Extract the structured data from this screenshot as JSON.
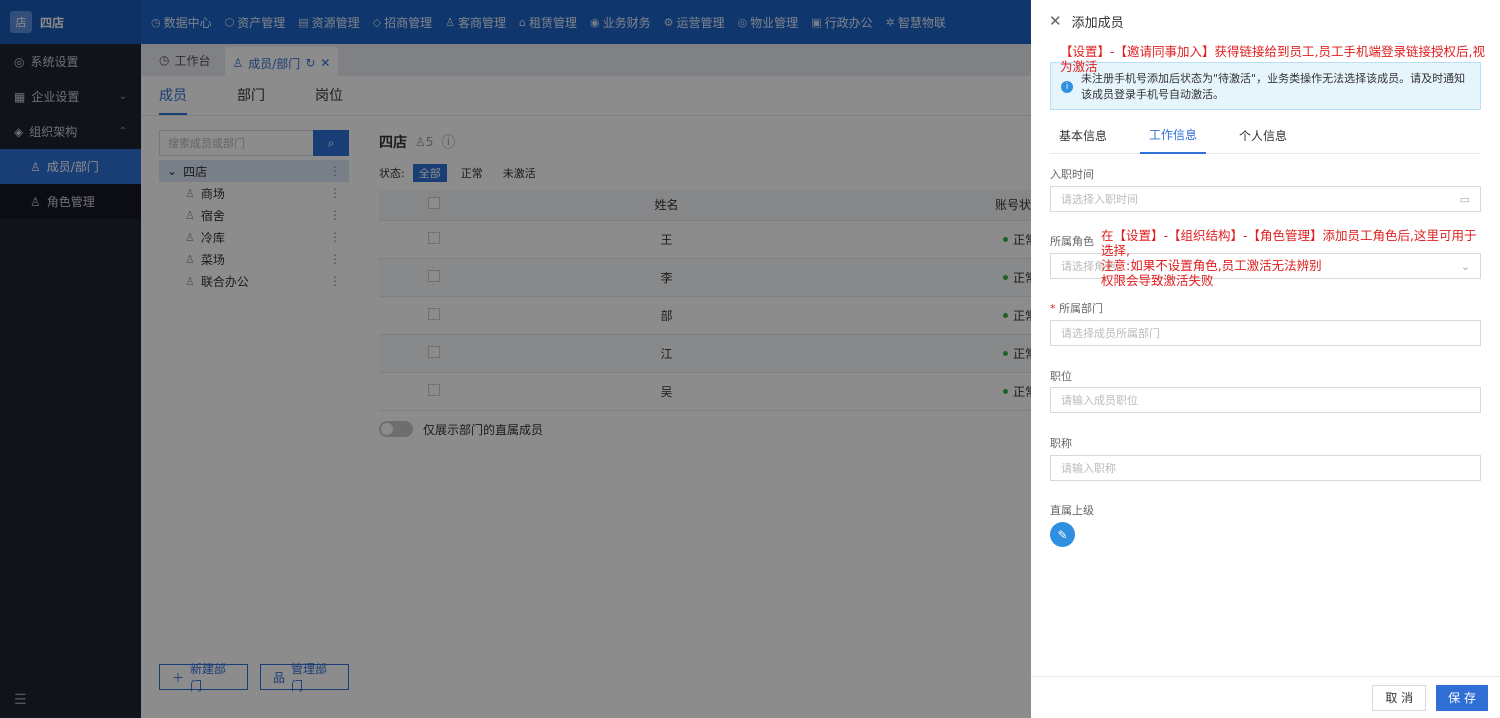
{
  "app": {
    "name": "四店",
    "logo_glyph": "店"
  },
  "topnav": {
    "items": [
      {
        "icon": "◷",
        "label": "数据中心"
      },
      {
        "icon": "⬡",
        "label": "资产管理"
      },
      {
        "icon": "▤",
        "label": "资源管理"
      },
      {
        "icon": "◇",
        "label": "招商管理"
      },
      {
        "icon": "♙",
        "label": "客商管理"
      },
      {
        "icon": "⌂",
        "label": "租赁管理"
      },
      {
        "icon": "◉",
        "label": "业务财务"
      },
      {
        "icon": "⚙",
        "label": "运营管理"
      },
      {
        "icon": "◎",
        "label": "物业管理"
      },
      {
        "icon": "▣",
        "label": "行政办公"
      },
      {
        "icon": "✲",
        "label": "智慧物联"
      }
    ]
  },
  "sidebar": {
    "items": [
      {
        "icon": "◎",
        "label": "系统设置"
      },
      {
        "icon": "▦",
        "label": "企业设置",
        "arrow": "⌄"
      },
      {
        "icon": "◈",
        "label": "组织架构",
        "arrow": "⌃"
      },
      {
        "icon": "♙",
        "label": "成员/部门"
      },
      {
        "icon": "♙",
        "label": "角色管理"
      }
    ],
    "footer_icon": "☰"
  },
  "tabbar": {
    "tabs": [
      {
        "icon": "◷",
        "label": "工作台"
      },
      {
        "icon": "♙",
        "label": "成员/部门",
        "refresh": "↻",
        "close": "✕"
      }
    ]
  },
  "main": {
    "subtabs": [
      "成员",
      "部门",
      "岗位"
    ],
    "search_placeholder": "搜索成员或部门",
    "search_icon": "⌕",
    "tree": {
      "root": "四店",
      "children": [
        "商场",
        "宿舍",
        "冷库",
        "菜场",
        "联合办公"
      ]
    },
    "buttons": {
      "new_dept": "新建部门",
      "manage_dept": "管理部门"
    },
    "dept_title": "四店",
    "dept_count": "5",
    "status_label": "状态:",
    "status_filters": [
      "全部",
      "正常",
      "未激活"
    ],
    "table": {
      "columns": [
        "姓名",
        "账号状"
      ],
      "rows": [
        {
          "name": "王",
          "status": "正常"
        },
        {
          "name": "李",
          "status": "正常"
        },
        {
          "name": "部",
          "status": "正常"
        },
        {
          "name": "江",
          "status": "正常"
        },
        {
          "name": "吴",
          "status": "正常"
        }
      ]
    },
    "toggle_label": "仅展示部门的直属成员"
  },
  "drawer": {
    "title": "添加成员",
    "annotation_top": "【设置】-【邀请同事加入】获得链接给到员工,员工手机端登录链接授权后,视为激活",
    "info_text": "未注册手机号添加后状态为\"待激活\"，业务类操作无法选择该成员。请及时通知该成员登录手机号自动激活。",
    "tabs": [
      "基本信息",
      "工作信息",
      "个人信息"
    ],
    "fields": {
      "join_date": {
        "label": "入职时间",
        "placeholder": "请选择入职时间"
      },
      "role": {
        "label": "所属角色",
        "placeholder": "请选择角色"
      },
      "dept": {
        "label": "所属部门",
        "placeholder": "请选择成员所属部门"
      },
      "position": {
        "label": "职位",
        "placeholder": "请输入成员职位"
      },
      "title": {
        "label": "职称",
        "placeholder": "请输入职称"
      },
      "supervisor": {
        "label": "直属上级"
      }
    },
    "annotation_role": "在【设置】-【组织结构】-【角色管理】添加员工角色后,这里可用于选择,\n注意:如果不设置角色,员工激活无法辨别\n权限会导致激活失败",
    "cancel": "取 消",
    "save": "保 存"
  }
}
